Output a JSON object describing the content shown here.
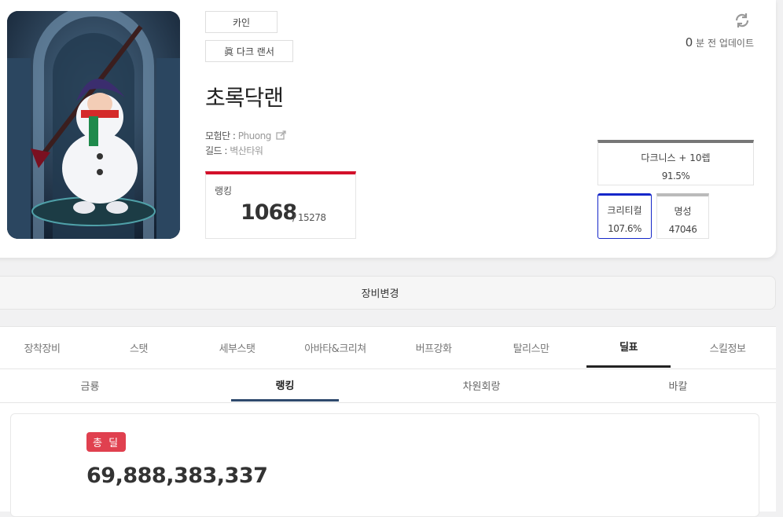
{
  "character": {
    "server": "카인",
    "job": "眞 다크 랜서",
    "name": "초록닥랜",
    "adventure_label": "모험단 : ",
    "adventure": "Phuong",
    "guild_label": "길드 : ",
    "guild": "벽산타워",
    "update_count": "0",
    "update_suffix": " 분 전 업데이트"
  },
  "ranking": {
    "label": "랭킹",
    "rank": "1068",
    "total": "/ 15278"
  },
  "stats": {
    "darkness": {
      "label": "다크니스 + 10렙",
      "value": "91.5%",
      "color": "#777777"
    },
    "critical": {
      "label": "크리티컬",
      "value": "107.6%",
      "color": "#1527c9"
    },
    "fame": {
      "label": "명성",
      "value": "47046",
      "color": "#bbbbbb"
    }
  },
  "equip_change_label": "장비변경",
  "main_tabs": [
    "장착장비",
    "스탯",
    "세부스탯",
    "아바타&크리쳐",
    "버프강화",
    "탈리스만",
    "딜표",
    "스킬정보"
  ],
  "main_tab_active": "딜표",
  "sub_tabs": [
    "금룡",
    "랭킹",
    "차원회랑",
    "바칼"
  ],
  "sub_tab_active": "랭킹",
  "damage": {
    "badge": "총 딜",
    "value": "69,888,383,337"
  },
  "colors": {
    "rank_accent": "#d3102a",
    "badge_bg": "#e0404f",
    "sub_tab_underline": "#2f4a6d"
  }
}
